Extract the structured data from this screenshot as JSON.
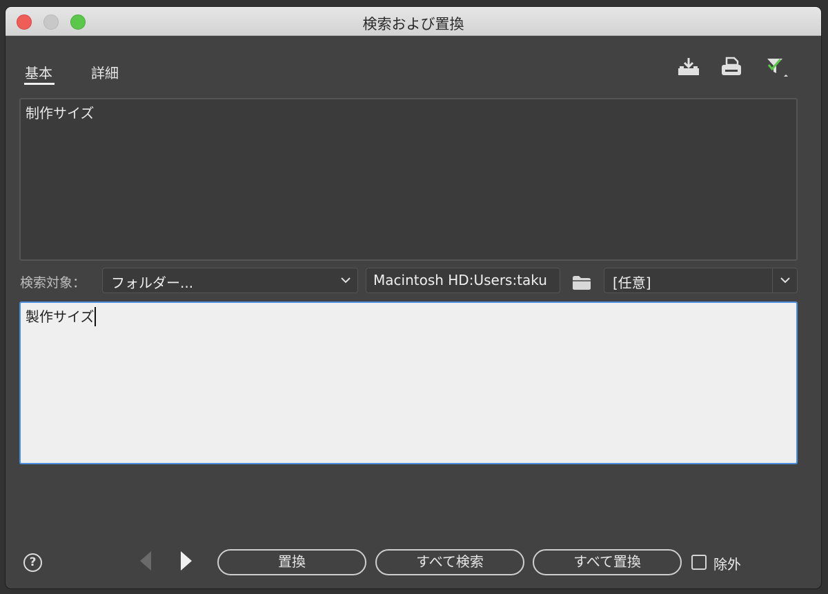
{
  "window": {
    "title": "検索および置換"
  },
  "tabs": [
    {
      "label": "基本",
      "active": true
    },
    {
      "label": "詳細",
      "active": false
    }
  ],
  "toolbar": {
    "icons": [
      "save-query-icon",
      "print-icon",
      "filter-icon"
    ]
  },
  "find": {
    "value": "制作サイズ"
  },
  "search_target": {
    "label": "検索対象：",
    "selected": "フォルダー...",
    "path": "Macintosh HD:Users:taku",
    "file_type": "[任意]"
  },
  "replace": {
    "value": "製作サイズ"
  },
  "footer": {
    "help": "?",
    "buttons": {
      "replace": "置換",
      "find_all": "すべて検索",
      "replace_all": "すべて置換"
    },
    "exclude_label": "除外",
    "exclude_checked": false
  },
  "colors": {
    "accent": "#4a8fe0",
    "check": "#5cc84b"
  }
}
